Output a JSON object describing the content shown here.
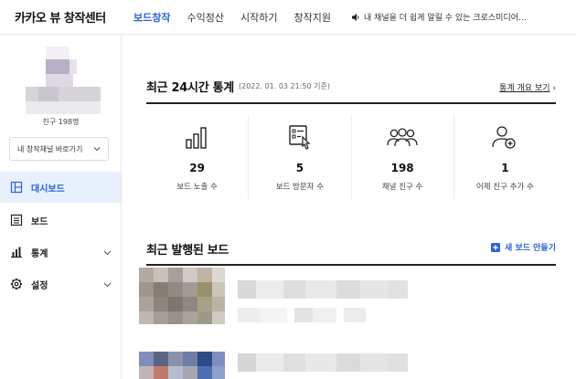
{
  "brand": "카카오 뷰 창작센터",
  "nav": [
    {
      "label": "보드창작",
      "active": true
    },
    {
      "label": "수익정산",
      "active": false
    },
    {
      "label": "시작하기",
      "active": false
    },
    {
      "label": "창작지원",
      "active": false
    }
  ],
  "notice": {
    "icon": "speaker-icon",
    "text": "내 채널을 더 쉽게 알릴 수 있는 크로스미디어…"
  },
  "sidebar": {
    "friends_label": "친구 198명",
    "channel_select": "내 창작채널 바로가기",
    "items": [
      {
        "label": "대시보드",
        "icon": "dashboard-icon",
        "active": true,
        "expandable": false
      },
      {
        "label": "보드",
        "icon": "board-list-icon",
        "active": false,
        "expandable": false
      },
      {
        "label": "통계",
        "icon": "bar-chart-icon",
        "active": false,
        "expandable": true
      },
      {
        "label": "설정",
        "icon": "gear-icon",
        "active": false,
        "expandable": true
      }
    ]
  },
  "stats_section": {
    "title": "최근 24시간 통계",
    "timestamp": "(2022. 01. 03 21:50 기준)",
    "link": "통계 개요 보기",
    "items": [
      {
        "value": "29",
        "label": "보드 노출 수",
        "icon": "bar-chart-icon"
      },
      {
        "value": "5",
        "label": "보드 방문자 수",
        "icon": "board-click-icon"
      },
      {
        "value": "198",
        "label": "채널 친구 수",
        "icon": "people-group-icon"
      },
      {
        "value": "1",
        "label": "어제 친구 추가 수",
        "icon": "person-add-icon"
      }
    ]
  },
  "boards_section": {
    "title": "최근 발행된 보드",
    "new_board_label": "새 보드 만들기"
  },
  "colors": {
    "accent": "#2b63d9",
    "active_bg": "#e8f0fd"
  }
}
